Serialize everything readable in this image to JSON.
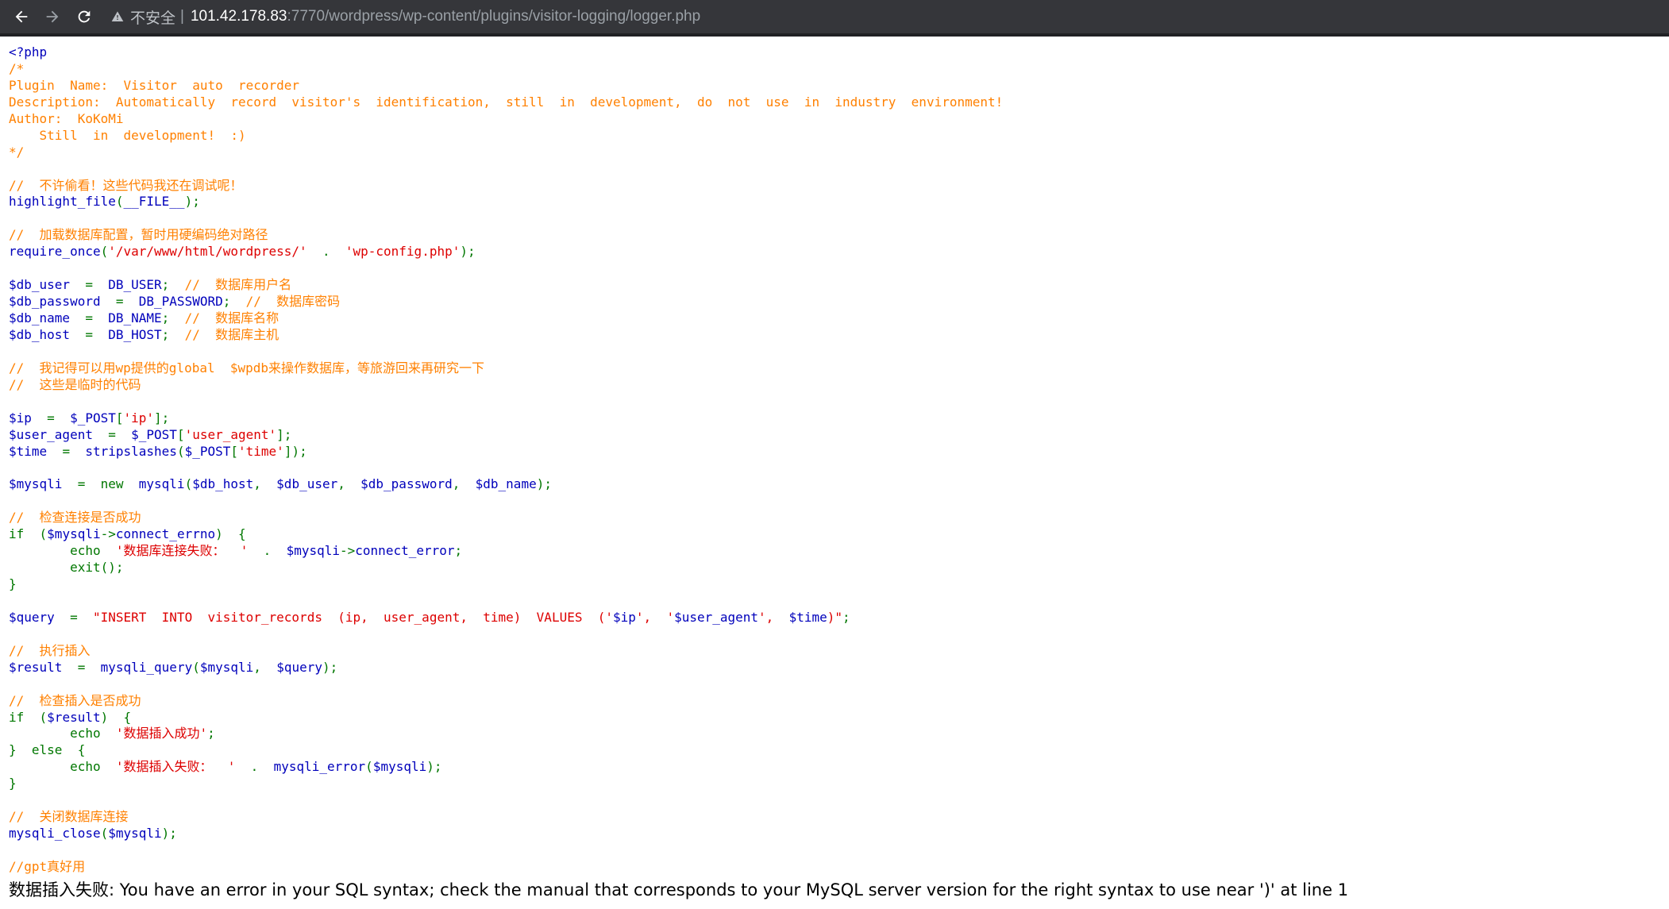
{
  "browser": {
    "insecure_label": "不安全",
    "separator": "|",
    "url_host": "101.42.178.83",
    "url_path": ":7770/wordpress/wp-content/plugins/visitor-logging/logger.php"
  },
  "code_lines": [
    [
      {
        "t": "<?php",
        "c": "d"
      }
    ],
    [
      {
        "t": "/*",
        "c": "c"
      }
    ],
    [
      {
        "t": "Plugin  Name:  Visitor  auto  recorder",
        "c": "c"
      }
    ],
    [
      {
        "t": "Description:  Automatically  record  visitor's  identification,  still  in  development,  do  not  use  in  industry  environment!",
        "c": "c"
      }
    ],
    [
      {
        "t": "Author:  KoKoMi",
        "c": "c"
      }
    ],
    [
      {
        "t": "    Still  in  development!  :)",
        "c": "c"
      }
    ],
    [
      {
        "t": "*/",
        "c": "c"
      }
    ],
    [],
    [
      {
        "t": "//  不许偷看！这些代码我还在调试呢！",
        "c": "c"
      }
    ],
    [
      {
        "t": "highlight_file",
        "c": "d"
      },
      {
        "t": "(",
        "c": "k"
      },
      {
        "t": "__FILE__",
        "c": "d"
      },
      {
        "t": ");",
        "c": "k"
      }
    ],
    [],
    [
      {
        "t": "//  加载数据库配置，暂时用硬编码绝对路径",
        "c": "c"
      }
    ],
    [
      {
        "t": "require_once",
        "c": "d"
      },
      {
        "t": "(",
        "c": "k"
      },
      {
        "t": "'/var/www/html/wordpress/'",
        "c": "s"
      },
      {
        "t": "  .  ",
        "c": "k"
      },
      {
        "t": "'wp-config.php'",
        "c": "s"
      },
      {
        "t": ");",
        "c": "k"
      }
    ],
    [],
    [
      {
        "t": "$db_user",
        "c": "d"
      },
      {
        "t": "  =  ",
        "c": "k"
      },
      {
        "t": "DB_USER",
        "c": "d"
      },
      {
        "t": ";  ",
        "c": "k"
      },
      {
        "t": "//  数据库用户名",
        "c": "c"
      }
    ],
    [
      {
        "t": "$db_password",
        "c": "d"
      },
      {
        "t": "  =  ",
        "c": "k"
      },
      {
        "t": "DB_PASSWORD",
        "c": "d"
      },
      {
        "t": ";  ",
        "c": "k"
      },
      {
        "t": "//  数据库密码",
        "c": "c"
      }
    ],
    [
      {
        "t": "$db_name",
        "c": "d"
      },
      {
        "t": "  =  ",
        "c": "k"
      },
      {
        "t": "DB_NAME",
        "c": "d"
      },
      {
        "t": ";  ",
        "c": "k"
      },
      {
        "t": "//  数据库名称",
        "c": "c"
      }
    ],
    [
      {
        "t": "$db_host",
        "c": "d"
      },
      {
        "t": "  =  ",
        "c": "k"
      },
      {
        "t": "DB_HOST",
        "c": "d"
      },
      {
        "t": ";  ",
        "c": "k"
      },
      {
        "t": "//  数据库主机",
        "c": "c"
      }
    ],
    [],
    [
      {
        "t": "//  我记得可以用wp提供的global  $wpdb来操作数据库，等旅游回来再研究一下",
        "c": "c"
      }
    ],
    [
      {
        "t": "//  这些是临时的代码",
        "c": "c"
      }
    ],
    [],
    [
      {
        "t": "$ip",
        "c": "d"
      },
      {
        "t": "  =  ",
        "c": "k"
      },
      {
        "t": "$_POST",
        "c": "d"
      },
      {
        "t": "[",
        "c": "k"
      },
      {
        "t": "'ip'",
        "c": "s"
      },
      {
        "t": "];",
        "c": "k"
      }
    ],
    [
      {
        "t": "$user_agent",
        "c": "d"
      },
      {
        "t": "  =  ",
        "c": "k"
      },
      {
        "t": "$_POST",
        "c": "d"
      },
      {
        "t": "[",
        "c": "k"
      },
      {
        "t": "'user_agent'",
        "c": "s"
      },
      {
        "t": "];",
        "c": "k"
      }
    ],
    [
      {
        "t": "$time",
        "c": "d"
      },
      {
        "t": "  =  ",
        "c": "k"
      },
      {
        "t": "stripslashes",
        "c": "d"
      },
      {
        "t": "(",
        "c": "k"
      },
      {
        "t": "$_POST",
        "c": "d"
      },
      {
        "t": "[",
        "c": "k"
      },
      {
        "t": "'time'",
        "c": "s"
      },
      {
        "t": "]);",
        "c": "k"
      }
    ],
    [],
    [
      {
        "t": "$mysqli",
        "c": "d"
      },
      {
        "t": "  =  new  ",
        "c": "k"
      },
      {
        "t": "mysqli",
        "c": "d"
      },
      {
        "t": "(",
        "c": "k"
      },
      {
        "t": "$db_host",
        "c": "d"
      },
      {
        "t": ",  ",
        "c": "k"
      },
      {
        "t": "$db_user",
        "c": "d"
      },
      {
        "t": ",  ",
        "c": "k"
      },
      {
        "t": "$db_password",
        "c": "d"
      },
      {
        "t": ",  ",
        "c": "k"
      },
      {
        "t": "$db_name",
        "c": "d"
      },
      {
        "t": ");",
        "c": "k"
      }
    ],
    [],
    [
      {
        "t": "//  检查连接是否成功",
        "c": "c"
      }
    ],
    [
      {
        "t": "if  (",
        "c": "k"
      },
      {
        "t": "$mysqli",
        "c": "d"
      },
      {
        "t": "->",
        "c": "k"
      },
      {
        "t": "connect_errno",
        "c": "d"
      },
      {
        "t": ")  {",
        "c": "k"
      }
    ],
    [
      {
        "t": "        echo  ",
        "c": "k"
      },
      {
        "t": "'数据库连接失败：  '",
        "c": "s"
      },
      {
        "t": "  .  ",
        "c": "k"
      },
      {
        "t": "$mysqli",
        "c": "d"
      },
      {
        "t": "->",
        "c": "k"
      },
      {
        "t": "connect_error",
        "c": "d"
      },
      {
        "t": ";",
        "c": "k"
      }
    ],
    [
      {
        "t": "        exit",
        "c": "k"
      },
      {
        "t": "();",
        "c": "k"
      }
    ],
    [
      {
        "t": "}",
        "c": "k"
      }
    ],
    [],
    [
      {
        "t": "$query",
        "c": "d"
      },
      {
        "t": "  =  ",
        "c": "k"
      },
      {
        "t": "\"INSERT  INTO  visitor_records  (ip,  user_agent,  time)  VALUES  ('",
        "c": "s"
      },
      {
        "t": "$ip",
        "c": "d"
      },
      {
        "t": "',  '",
        "c": "s"
      },
      {
        "t": "$user_agent",
        "c": "d"
      },
      {
        "t": "',  ",
        "c": "s"
      },
      {
        "t": "$time",
        "c": "d"
      },
      {
        "t": ")\"",
        "c": "s"
      },
      {
        "t": ";",
        "c": "k"
      }
    ],
    [],
    [
      {
        "t": "//  执行插入",
        "c": "c"
      }
    ],
    [
      {
        "t": "$result",
        "c": "d"
      },
      {
        "t": "  =  ",
        "c": "k"
      },
      {
        "t": "mysqli_query",
        "c": "d"
      },
      {
        "t": "(",
        "c": "k"
      },
      {
        "t": "$mysqli",
        "c": "d"
      },
      {
        "t": ",  ",
        "c": "k"
      },
      {
        "t": "$query",
        "c": "d"
      },
      {
        "t": ");",
        "c": "k"
      }
    ],
    [],
    [
      {
        "t": "//  检查插入是否成功",
        "c": "c"
      }
    ],
    [
      {
        "t": "if  (",
        "c": "k"
      },
      {
        "t": "$result",
        "c": "d"
      },
      {
        "t": ")  {",
        "c": "k"
      }
    ],
    [
      {
        "t": "        echo  ",
        "c": "k"
      },
      {
        "t": "'数据插入成功'",
        "c": "s"
      },
      {
        "t": ";",
        "c": "k"
      }
    ],
    [
      {
        "t": "}  else  {",
        "c": "k"
      }
    ],
    [
      {
        "t": "        echo  ",
        "c": "k"
      },
      {
        "t": "'数据插入失败：  '",
        "c": "s"
      },
      {
        "t": "  .  ",
        "c": "k"
      },
      {
        "t": "mysqli_error",
        "c": "d"
      },
      {
        "t": "(",
        "c": "k"
      },
      {
        "t": "$mysqli",
        "c": "d"
      },
      {
        "t": ");",
        "c": "k"
      }
    ],
    [
      {
        "t": "}",
        "c": "k"
      }
    ],
    [],
    [
      {
        "t": "//  关闭数据库连接",
        "c": "c"
      }
    ],
    [
      {
        "t": "mysqli_close",
        "c": "d"
      },
      {
        "t": "(",
        "c": "k"
      },
      {
        "t": "$mysqli",
        "c": "d"
      },
      {
        "t": ");",
        "c": "k"
      }
    ],
    [],
    [
      {
        "t": "//gpt真好用",
        "c": "c"
      }
    ]
  ],
  "error_output": "数据插入失败: You have an error in your SQL syntax; check the manual that corresponds to your MySQL server version for the right syntax to use near ')' at line 1"
}
